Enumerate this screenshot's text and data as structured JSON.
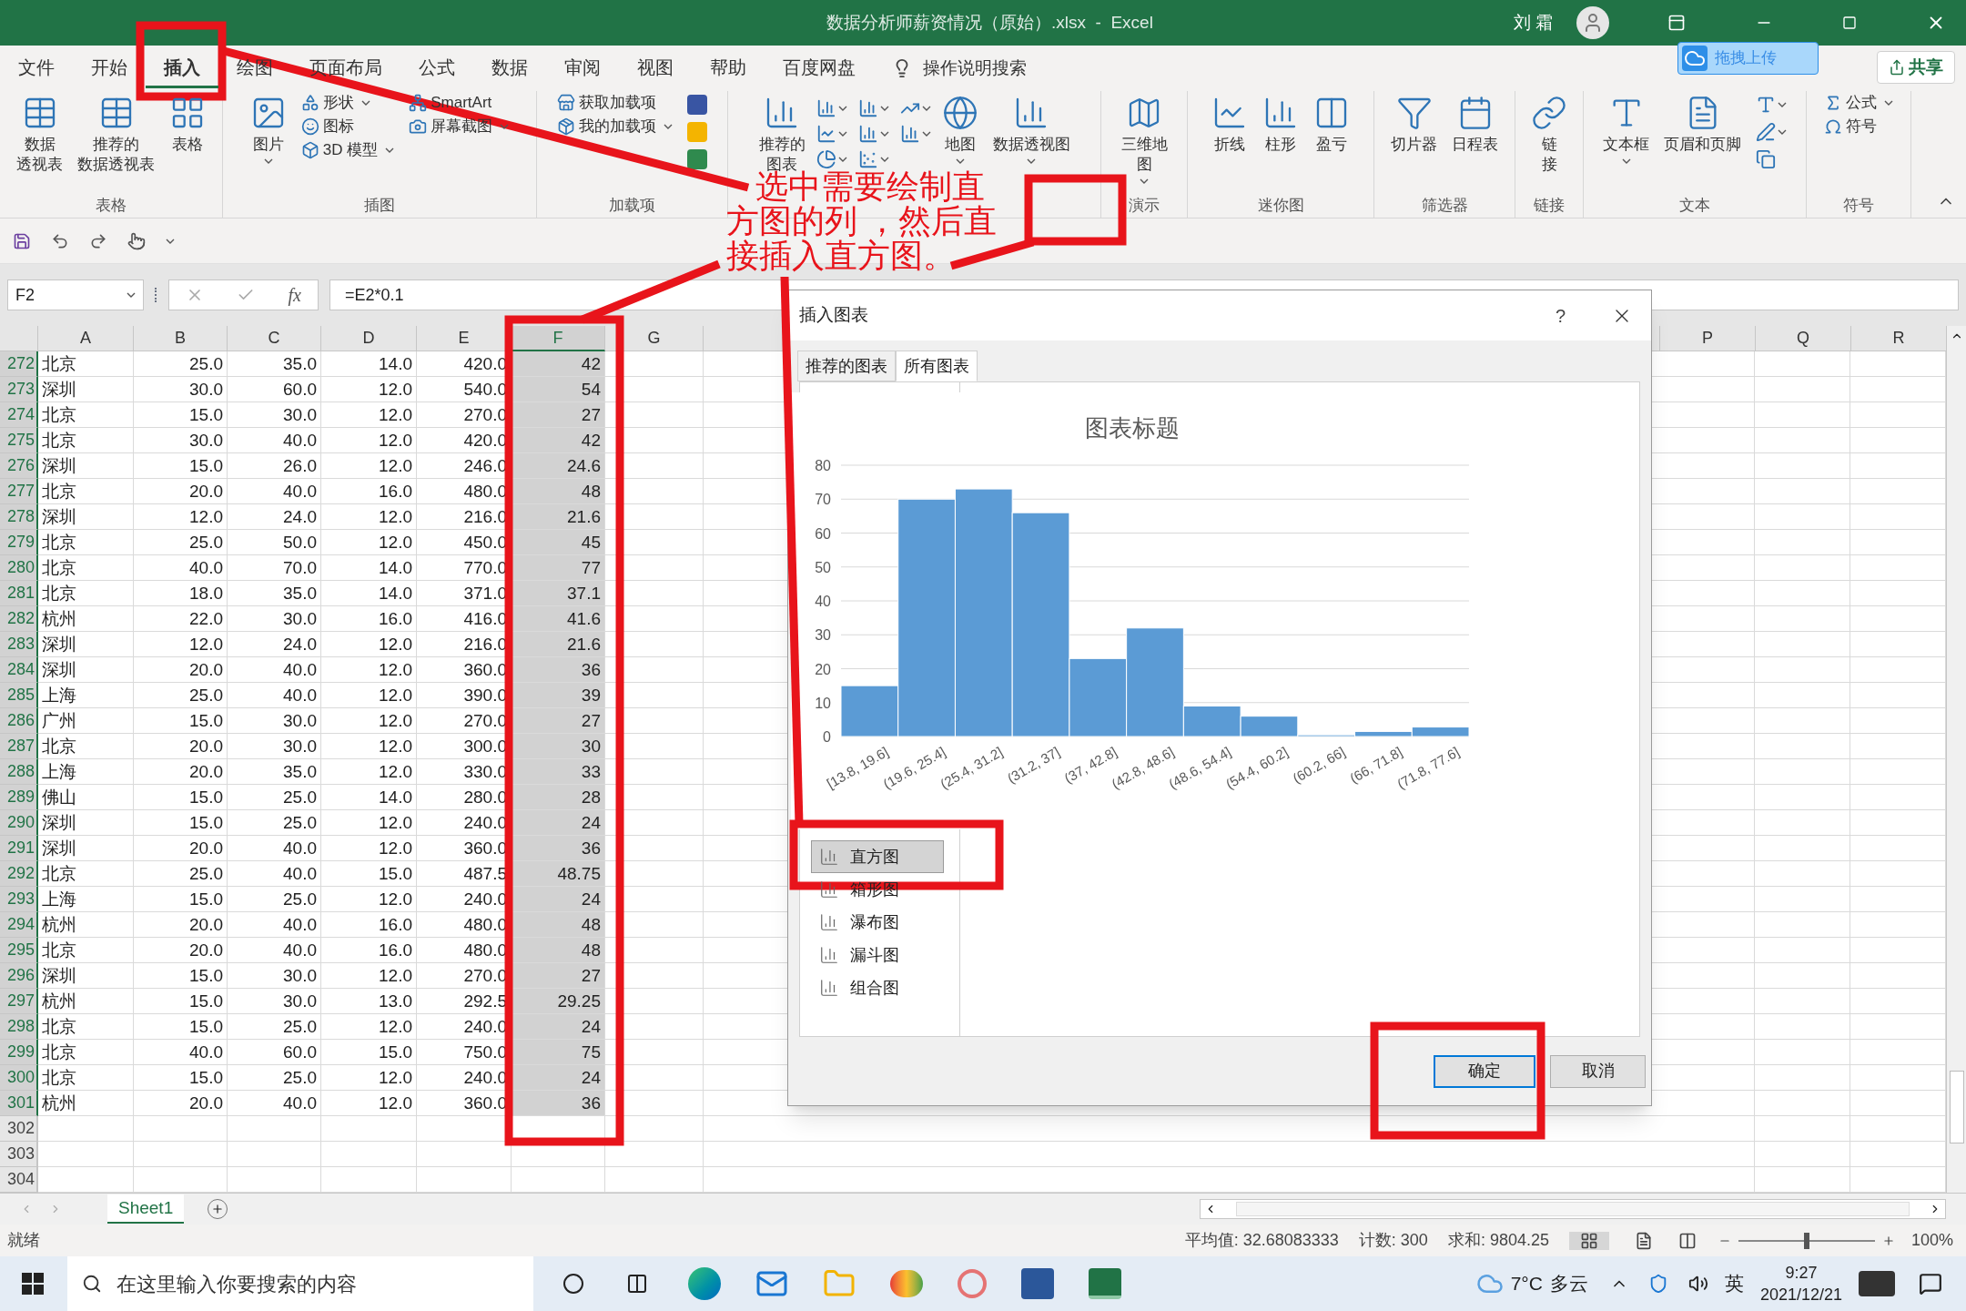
{
  "window": {
    "title": "数据分析师薪资情况（原始）.xlsx  -  Excel",
    "user": "刘 霜"
  },
  "menu_tabs": [
    {
      "label": "文件",
      "selected": false
    },
    {
      "label": "开始",
      "selected": false
    },
    {
      "label": "插入",
      "selected": true
    },
    {
      "label": "绘图",
      "selected": false
    },
    {
      "label": "页面布局",
      "selected": false
    },
    {
      "label": "公式",
      "selected": false
    },
    {
      "label": "数据",
      "selected": false
    },
    {
      "label": "审阅",
      "selected": false
    },
    {
      "label": "视图",
      "selected": false
    },
    {
      "label": "帮助",
      "selected": false
    },
    {
      "label": "百度网盘",
      "selected": false
    }
  ],
  "tell_me": "操作说明搜索",
  "upload_button": "拖拽上传",
  "share_button": "共享",
  "ribbon": [
    {
      "label": "表格",
      "items": [
        {
          "kind": "large",
          "lines": [
            "数据",
            "透视表"
          ],
          "dropdown": false
        },
        {
          "kind": "large",
          "lines": [
            "推荐的",
            "数据透视表"
          ],
          "dropdown": false
        },
        {
          "kind": "large",
          "lines": [
            "表格"
          ],
          "dropdown": false
        }
      ]
    },
    {
      "label": "插图",
      "items": [
        {
          "kind": "large",
          "lines": [
            "图片"
          ],
          "dropdown": true
        },
        {
          "kind": "stack",
          "items": [
            {
              "label": "形状",
              "dropdown": true
            },
            {
              "label": "图标",
              "dropdown": false
            },
            {
              "label": "3D 模型",
              "dropdown": true
            }
          ]
        },
        {
          "kind": "stack",
          "items": [
            {
              "label": "SmartArt",
              "dropdown": false
            },
            {
              "label": "屏幕截图",
              "dropdown": true
            }
          ]
        }
      ]
    },
    {
      "label": "加载项",
      "items": [
        {
          "kind": "stack",
          "items": [
            {
              "label": "获取加载项",
              "dropdown": false
            },
            {
              "label": "我的加载项",
              "dropdown": true
            }
          ]
        },
        {
          "kind": "app-icons"
        }
      ]
    },
    {
      "items": [
        {
          "kind": "large",
          "lines": [
            "推荐的",
            "图表"
          ],
          "dropdown": false
        },
        {
          "kind": "chart-icons"
        },
        {
          "kind": "large",
          "lines": [
            "地图"
          ],
          "dropdown": true
        },
        {
          "kind": "large",
          "lines": [
            "数据透视图"
          ],
          "dropdown": true
        }
      ]
    },
    {
      "label": "演示",
      "items": [
        {
          "kind": "large",
          "lines": [
            "三维地",
            "图"
          ],
          "dropdown": true
        }
      ]
    },
    {
      "label": "迷你图",
      "items": [
        {
          "kind": "large",
          "lines": [
            "折线"
          ],
          "dropdown": false
        },
        {
          "kind": "large",
          "lines": [
            "柱形"
          ],
          "dropdown": false
        },
        {
          "kind": "large",
          "lines": [
            "盈亏"
          ],
          "dropdown": false
        }
      ]
    },
    {
      "label": "筛选器",
      "items": [
        {
          "kind": "large",
          "lines": [
            "切片器"
          ],
          "dropdown": false
        },
        {
          "kind": "large",
          "lines": [
            "日程表"
          ],
          "dropdown": false
        }
      ]
    },
    {
      "label": "链接",
      "items": [
        {
          "kind": "large",
          "lines": [
            "链",
            "接"
          ],
          "dropdown": false
        }
      ]
    },
    {
      "label": "文本",
      "items": [
        {
          "kind": "large",
          "lines": [
            "文本框"
          ],
          "dropdown": true
        },
        {
          "kind": "large",
          "lines": [
            "页眉和页脚"
          ],
          "dropdown": false
        },
        {
          "kind": "text-icons"
        }
      ]
    },
    {
      "label": "符号",
      "items": [
        {
          "kind": "stack",
          "items": [
            {
              "label": "公式",
              "dropdown": true
            },
            {
              "label": "符号",
              "dropdown": false
            }
          ]
        }
      ]
    }
  ],
  "name_box": "F2",
  "formula_icon": "fx",
  "formula": "=E2*0.1",
  "columns": [
    {
      "label": "A",
      "selected": false
    },
    {
      "label": "B",
      "selected": false
    },
    {
      "label": "C",
      "selected": false
    },
    {
      "label": "D",
      "selected": false
    },
    {
      "label": "E",
      "selected": false
    },
    {
      "label": "F",
      "selected": true
    },
    {
      "label": "G",
      "selected": false
    },
    {
      "label": "P",
      "selected": false
    },
    {
      "label": "Q",
      "selected": false
    },
    {
      "label": "R",
      "selected": false
    }
  ],
  "rows": [
    {
      "n": "272",
      "selected": true,
      "cells": [
        "北京",
        "25.0",
        "35.0",
        "14.0",
        "420.0",
        "42"
      ]
    },
    {
      "n": "273",
      "selected": true,
      "cells": [
        "深圳",
        "30.0",
        "60.0",
        "12.0",
        "540.0",
        "54"
      ]
    },
    {
      "n": "274",
      "selected": true,
      "cells": [
        "北京",
        "15.0",
        "30.0",
        "12.0",
        "270.0",
        "27"
      ]
    },
    {
      "n": "275",
      "selected": true,
      "cells": [
        "北京",
        "30.0",
        "40.0",
        "12.0",
        "420.0",
        "42"
      ]
    },
    {
      "n": "276",
      "selected": true,
      "cells": [
        "深圳",
        "15.0",
        "26.0",
        "12.0",
        "246.0",
        "24.6"
      ]
    },
    {
      "n": "277",
      "selected": true,
      "cells": [
        "北京",
        "20.0",
        "40.0",
        "16.0",
        "480.0",
        "48"
      ]
    },
    {
      "n": "278",
      "selected": true,
      "cells": [
        "深圳",
        "12.0",
        "24.0",
        "12.0",
        "216.0",
        "21.6"
      ]
    },
    {
      "n": "279",
      "selected": true,
      "cells": [
        "北京",
        "25.0",
        "50.0",
        "12.0",
        "450.0",
        "45"
      ]
    },
    {
      "n": "280",
      "selected": true,
      "cells": [
        "北京",
        "40.0",
        "70.0",
        "14.0",
        "770.0",
        "77"
      ]
    },
    {
      "n": "281",
      "selected": true,
      "cells": [
        "北京",
        "18.0",
        "35.0",
        "14.0",
        "371.0",
        "37.1"
      ]
    },
    {
      "n": "282",
      "selected": true,
      "cells": [
        "杭州",
        "22.0",
        "30.0",
        "16.0",
        "416.0",
        "41.6"
      ]
    },
    {
      "n": "283",
      "selected": true,
      "cells": [
        "深圳",
        "12.0",
        "24.0",
        "12.0",
        "216.0",
        "21.6"
      ]
    },
    {
      "n": "284",
      "selected": true,
      "cells": [
        "深圳",
        "20.0",
        "40.0",
        "12.0",
        "360.0",
        "36"
      ]
    },
    {
      "n": "285",
      "selected": true,
      "cells": [
        "上海",
        "25.0",
        "40.0",
        "12.0",
        "390.0",
        "39"
      ]
    },
    {
      "n": "286",
      "selected": true,
      "cells": [
        "广州",
        "15.0",
        "30.0",
        "12.0",
        "270.0",
        "27"
      ]
    },
    {
      "n": "287",
      "selected": true,
      "cells": [
        "北京",
        "20.0",
        "30.0",
        "12.0",
        "300.0",
        "30"
      ]
    },
    {
      "n": "288",
      "selected": true,
      "cells": [
        "上海",
        "20.0",
        "35.0",
        "12.0",
        "330.0",
        "33"
      ]
    },
    {
      "n": "289",
      "selected": true,
      "cells": [
        "佛山",
        "15.0",
        "25.0",
        "14.0",
        "280.0",
        "28"
      ]
    },
    {
      "n": "290",
      "selected": true,
      "cells": [
        "深圳",
        "15.0",
        "25.0",
        "12.0",
        "240.0",
        "24"
      ]
    },
    {
      "n": "291",
      "selected": true,
      "cells": [
        "深圳",
        "20.0",
        "40.0",
        "12.0",
        "360.0",
        "36"
      ]
    },
    {
      "n": "292",
      "selected": true,
      "cells": [
        "北京",
        "25.0",
        "40.0",
        "15.0",
        "487.5",
        "48.75"
      ]
    },
    {
      "n": "293",
      "selected": true,
      "cells": [
        "上海",
        "15.0",
        "25.0",
        "12.0",
        "240.0",
        "24"
      ]
    },
    {
      "n": "294",
      "selected": true,
      "cells": [
        "杭州",
        "20.0",
        "40.0",
        "16.0",
        "480.0",
        "48"
      ]
    },
    {
      "n": "295",
      "selected": true,
      "cells": [
        "北京",
        "20.0",
        "40.0",
        "16.0",
        "480.0",
        "48"
      ]
    },
    {
      "n": "296",
      "selected": true,
      "cells": [
        "深圳",
        "15.0",
        "30.0",
        "12.0",
        "270.0",
        "27"
      ]
    },
    {
      "n": "297",
      "selected": true,
      "cells": [
        "杭州",
        "15.0",
        "30.0",
        "13.0",
        "292.5",
        "29.25"
      ]
    },
    {
      "n": "298",
      "selected": true,
      "cells": [
        "北京",
        "15.0",
        "25.0",
        "12.0",
        "240.0",
        "24"
      ]
    },
    {
      "n": "299",
      "selected": true,
      "cells": [
        "北京",
        "40.0",
        "60.0",
        "15.0",
        "750.0",
        "75"
      ]
    },
    {
      "n": "300",
      "selected": true,
      "cells": [
        "北京",
        "15.0",
        "25.0",
        "12.0",
        "240.0",
        "24"
      ]
    },
    {
      "n": "301",
      "selected": true,
      "cells": [
        "杭州",
        "20.0",
        "40.0",
        "12.0",
        "360.0",
        "36"
      ]
    },
    {
      "n": "302",
      "selected": false,
      "cells": []
    },
    {
      "n": "303",
      "selected": false,
      "cells": []
    },
    {
      "n": "304",
      "selected": false,
      "cells": []
    }
  ],
  "sheet_tabs": [
    {
      "label": "Sheet1",
      "selected": true
    }
  ],
  "status_bar": {
    "ready": "就绪",
    "average": "平均值: 32.68083333",
    "count": "计数: 300",
    "sum": "求和: 9804.25",
    "zoom_slider": {
      "level": 0.5
    },
    "zoom": "100%"
  },
  "taskbar": {
    "search_placeholder": "在这里输入你要搜索的内容",
    "temperature": "7°C",
    "weather": "多云",
    "ime": "英",
    "time": "9:27",
    "date": "2021/12/21"
  },
  "dialog": {
    "title": "插入图表",
    "help": "?",
    "tabs": [
      {
        "label": "推荐的图表",
        "selected": false
      },
      {
        "label": "所有图表",
        "selected": true
      }
    ],
    "chart_types": [
      {
        "label": "直方图",
        "selected": true
      },
      {
        "label": "箱形图",
        "selected": false
      },
      {
        "label": "瀑布图",
        "selected": false
      },
      {
        "label": "漏斗图",
        "selected": false
      },
      {
        "label": "组合图",
        "selected": false
      }
    ],
    "preview": {
      "chart_data": {
        "type": "bar",
        "title": "图表标题",
        "categories": [
          "[13.8, 19.6]",
          "(19.6, 25.4]",
          "(25.4, 31.2]",
          "(31.2, 37]",
          "(37, 42.8]",
          "(42.8, 48.6]",
          "(48.6, 54.4]",
          "(54.4, 60.2]",
          "(60.2, 66]",
          "(66, 71.8]",
          "(71.8, 77.6]"
        ],
        "values": [
          15,
          70,
          73,
          66,
          23,
          32,
          9,
          6,
          0.5,
          1.5,
          2.8
        ],
        "ylim": [
          0,
          80
        ],
        "grid": true,
        "yticks": [
          0,
          10,
          20,
          30,
          40,
          50,
          60,
          70,
          80
        ]
      }
    },
    "buttons": [
      {
        "label": "确定",
        "kind": "default"
      },
      {
        "label": "取消",
        "kind": "normal"
      }
    ]
  },
  "annotation": {
    "lines": [
      "选中需要绘制直",
      "方图的列 ，然后直",
      "接插入直方图。"
    ]
  }
}
